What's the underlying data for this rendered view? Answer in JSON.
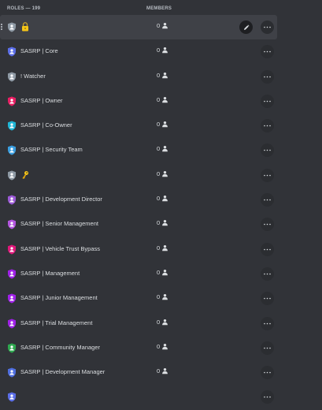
{
  "header": {
    "roles_label": "ROLES — 199",
    "members_label": "MEMBERS"
  },
  "icons": {
    "person": "person-icon",
    "more": "more-options-icon",
    "edit": "pencil-icon",
    "drag": "drag-handle-icon"
  },
  "roles": [
    {
      "name": "",
      "emoji": "lock",
      "color": "#8f9aa5",
      "members": "0",
      "hover": true
    },
    {
      "name": "SASRP | Core",
      "color": "#5b6ee8",
      "members": "0"
    },
    {
      "name": "! Watcher",
      "color": "#8f9aa5",
      "members": "0"
    },
    {
      "name": "SASRP | Owner",
      "color": "#e91e63",
      "members": "0"
    },
    {
      "name": "SASRP | Co-Owner",
      "color": "#1fb6d6",
      "members": "0"
    },
    {
      "name": "SASRP | Security Team",
      "color": "#3a9ee0",
      "members": "0"
    },
    {
      "name": "",
      "emoji": "key",
      "color": "#8f9aa5",
      "members": "0"
    },
    {
      "name": "SASRP | Development Director",
      "color": "#9b59d6",
      "members": "0"
    },
    {
      "name": "SASRP | Senior Management",
      "color": "#b455e0",
      "members": "0"
    },
    {
      "name": "SASRP | Vehicle Trust Bypass",
      "color": "#e0177a",
      "members": "0"
    },
    {
      "name": "SASRP | Management",
      "color": "#a020e8",
      "members": "0"
    },
    {
      "name": "SASRP | Junior Management",
      "color": "#a020e8",
      "members": "0"
    },
    {
      "name": "SASRP | Trial Management",
      "color": "#a020e8",
      "members": "0"
    },
    {
      "name": "SASRP | Community Manager",
      "color": "#2ea84f",
      "members": "0"
    },
    {
      "name": "SASRP | Development Manager",
      "color": "#4f6fe0",
      "members": "0"
    },
    {
      "name": "",
      "color": "#5b6ee8",
      "members": ""
    }
  ]
}
